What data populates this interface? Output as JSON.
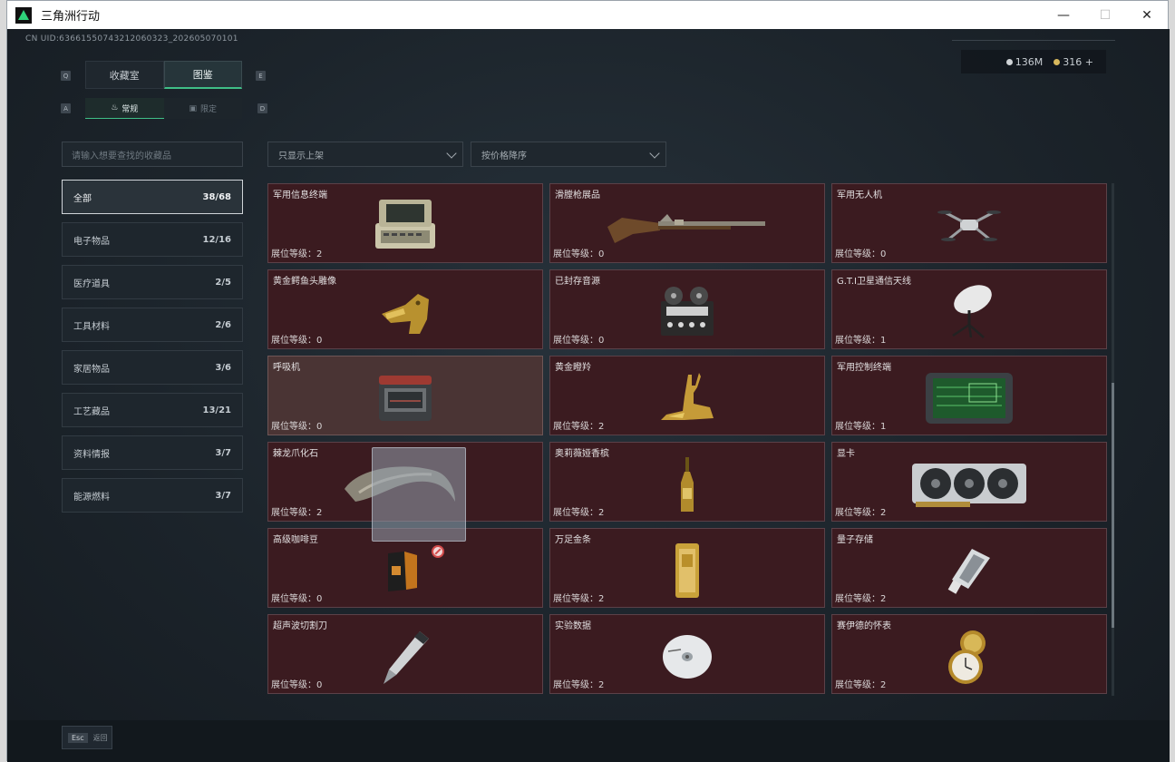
{
  "window": {
    "title": "三角洲行动",
    "minimize": "—",
    "maximize": "☐",
    "close": "✕"
  },
  "uid": "CN UID:63661550743212060323_202605070101",
  "currency": {
    "silver": "136M",
    "gold": "316",
    "add": "+"
  },
  "keys": {
    "q": "Q",
    "e": "E",
    "a": "A",
    "d": "D"
  },
  "tabs": [
    {
      "label": "收藏室",
      "active": false
    },
    {
      "label": "图鉴",
      "active": true
    }
  ],
  "subtabs": [
    {
      "label": "常规",
      "active": true
    },
    {
      "label": "限定",
      "active": false
    }
  ],
  "search": {
    "placeholder": "请输入想要查找的收藏品"
  },
  "filters": {
    "shelf": "只显示上架",
    "sort": "按价格降序"
  },
  "categories": [
    {
      "name": "全部",
      "count": "38/68",
      "active": true
    },
    {
      "name": "电子物品",
      "count": "12/16"
    },
    {
      "name": "医疗道具",
      "count": "2/5"
    },
    {
      "name": "工具材料",
      "count": "2/6"
    },
    {
      "name": "家居物品",
      "count": "3/6"
    },
    {
      "name": "工艺藏品",
      "count": "13/21"
    },
    {
      "name": "资料情报",
      "count": "3/7"
    },
    {
      "name": "能源燃料",
      "count": "3/7"
    }
  ],
  "items": [
    {
      "name": "军用信息终端",
      "level": "展位等级：2",
      "icon": "military-terminal-icon"
    },
    {
      "name": "滑膛枪展品",
      "level": "展位等级：0",
      "icon": "musket-icon"
    },
    {
      "name": "军用无人机",
      "level": "展位等级：0",
      "icon": "drone-icon"
    },
    {
      "name": "黄金鳄鱼头雕像",
      "level": "展位等级：0",
      "icon": "gold-crocodile-statue-icon"
    },
    {
      "name": "已封存音源",
      "level": "展位等级：0",
      "icon": "tape-recorder-icon"
    },
    {
      "name": "G.T.I卫星通信天线",
      "level": "展位等级：1",
      "icon": "satellite-antenna-icon"
    },
    {
      "name": "呼吸机",
      "level": "展位等级：0",
      "icon": "ventilator-icon"
    },
    {
      "name": "黄金瞪羚",
      "level": "展位等级：2",
      "icon": "gold-gazelle-icon"
    },
    {
      "name": "军用控制终端",
      "level": "展位等级：1",
      "icon": "control-terminal-icon"
    },
    {
      "name": "棘龙爪化石",
      "level": "展位等级：2",
      "icon": "claw-fossil-icon"
    },
    {
      "name": "奥莉薇娅香槟",
      "level": "展位等级：2",
      "icon": "champagne-icon"
    },
    {
      "name": "显卡",
      "level": "展位等级：2",
      "icon": "graphics-card-icon"
    },
    {
      "name": "高级咖啡豆",
      "level": "展位等级：0",
      "icon": "coffee-beans-icon"
    },
    {
      "name": "万足金条",
      "level": "展位等级：2",
      "icon": "gold-bar-icon"
    },
    {
      "name": "量子存储",
      "level": "展位等级：2",
      "icon": "quantum-storage-icon"
    },
    {
      "name": "超声波切割刀",
      "level": "展位等级：0",
      "icon": "ultrasonic-cutter-icon"
    },
    {
      "name": "实验数据",
      "level": "展位等级：2",
      "icon": "data-disc-icon"
    },
    {
      "name": "赛伊德的怀表",
      "level": "展位等级：2",
      "icon": "pocket-watch-icon"
    }
  ],
  "footer": {
    "esc": "Esc",
    "back": "返回"
  }
}
